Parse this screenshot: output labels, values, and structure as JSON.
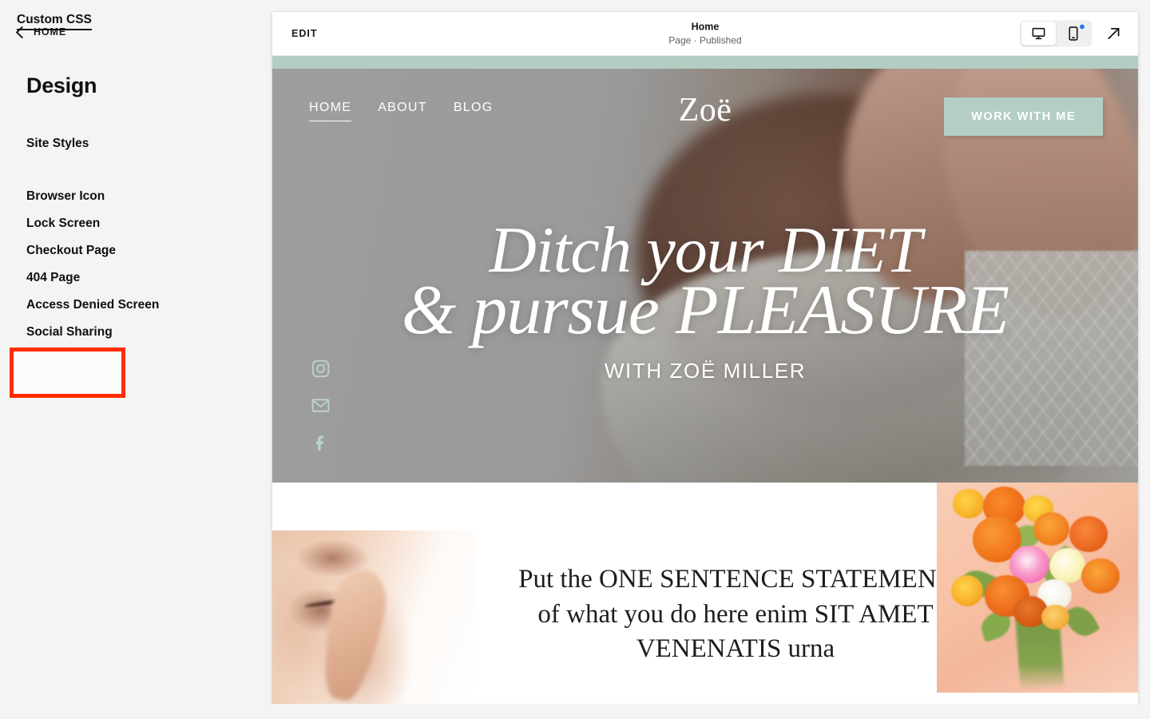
{
  "sidebar": {
    "back_label": "HOME",
    "back_icon": "chevron-left-icon",
    "title": "Design",
    "site_styles_label": "Site Styles",
    "items": [
      {
        "label": "Browser Icon"
      },
      {
        "label": "Lock Screen"
      },
      {
        "label": "Checkout Page"
      },
      {
        "label": "404 Page"
      },
      {
        "label": "Access Denied Screen"
      },
      {
        "label": "Social Sharing"
      }
    ],
    "highlighted_item": {
      "label": "Custom CSS",
      "highlight_color": "#ff2d00",
      "underlined": true
    }
  },
  "toolbar": {
    "edit_label": "EDIT",
    "page_title": "Home",
    "page_status": "Page · Published",
    "desktop_icon": "desktop-monitor-icon",
    "mobile_icon": "mobile-phone-icon",
    "mobile_badge_color": "#2878f0",
    "external_link_icon": "arrow-up-right-icon",
    "selected_device": "desktop"
  },
  "site": {
    "accent_color": "#b4cec4",
    "nav": [
      {
        "label": "HOME",
        "active": true
      },
      {
        "label": "ABOUT",
        "active": false
      },
      {
        "label": "BLOG",
        "active": false
      }
    ],
    "brand": "Zoë",
    "cta_label": "WORK WITH ME",
    "headline_line1": "Ditch your DIET",
    "headline_line2": "& pursue PLEASURE",
    "headline_subtitle": "WITH ZOË MILLER",
    "socials": [
      {
        "name": "instagram-icon"
      },
      {
        "name": "email-icon"
      },
      {
        "name": "facebook-icon"
      }
    ],
    "statement": "Put the ONE SENTENCE STATEMENT of what you do here enim SIT AMET VENENATIS urna",
    "images": {
      "hero_alt": "hands dipping into a bowl of melted chocolate",
      "left_alt": "close-up of lips and finger",
      "right_alt": "orange ranunculus bouquet on peach background"
    }
  }
}
